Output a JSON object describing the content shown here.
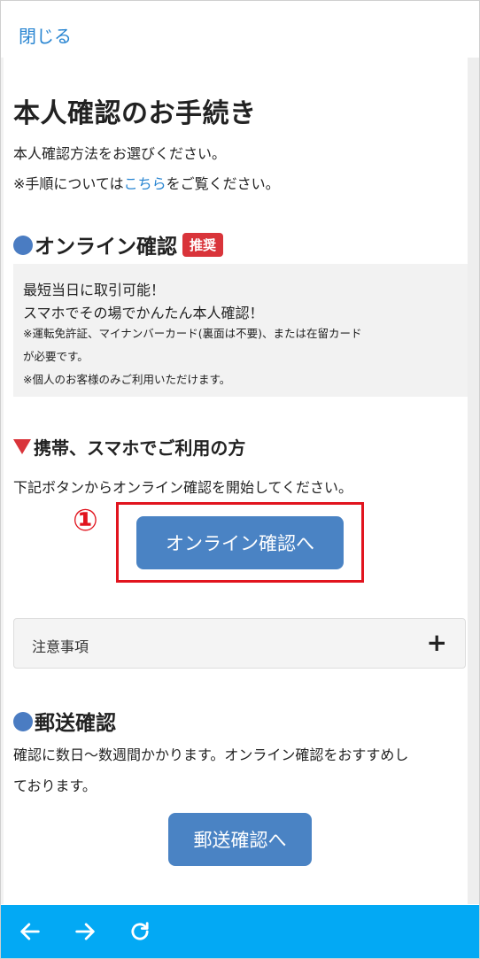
{
  "header": {
    "close_label": "閉じる"
  },
  "page": {
    "title": "本人確認のお手続き",
    "intro": "本人確認方法をお選びください。",
    "intro_note_prefix": "※手順については",
    "intro_note_link": "こちら",
    "intro_note_suffix": "をご覧ください。"
  },
  "online_section": {
    "heading": "オンライン確認",
    "badge": "推奨",
    "notes": [
      "最短当日に取引可能！",
      "スマホでその場でかんたん本人確認！",
      "※運転免許証、マイナンバーカード(裏面は不要)、または在留カード",
      "が必要です。",
      "※個人のお客様のみご利用いただけます。"
    ]
  },
  "mobile_section": {
    "heading": "携帯、スマホでご利用の方",
    "description": "下記ボタンからオンライン確認を開始してください。",
    "marker": "①",
    "button_label": "オンライン確認へ"
  },
  "accordion": {
    "label": "注意事項",
    "toggle": "+"
  },
  "postal_section": {
    "heading": "郵送確認",
    "description_line1": "確認に数日〜数週間かかります。オンライン確認をおすすめし",
    "description_line2": "ております。",
    "button_label": "郵送確認へ"
  },
  "navbar": {
    "icons": [
      "back-arrow-icon",
      "forward-arrow-icon",
      "reload-icon"
    ]
  },
  "colors": {
    "accent": "#4a83c4",
    "badge": "#d9343a",
    "highlight": "#e1141e",
    "navbar": "#03a9f4",
    "link": "#2a86d2"
  }
}
